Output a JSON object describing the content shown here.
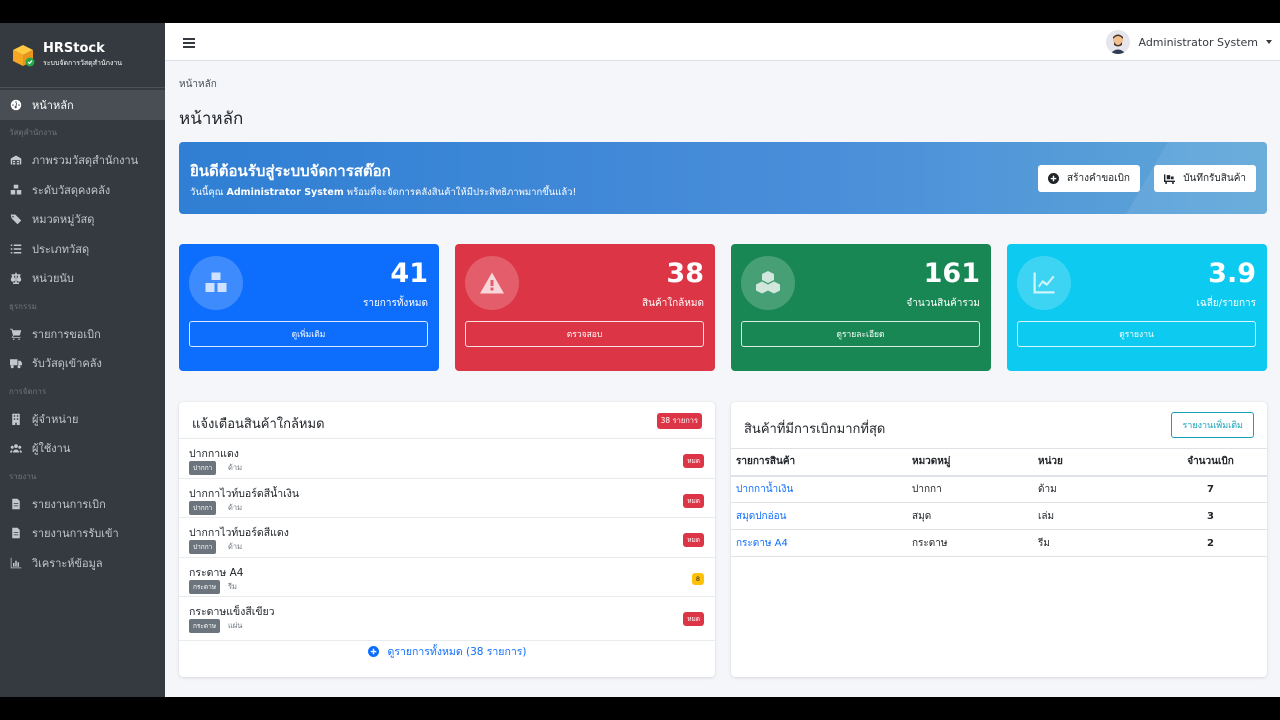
{
  "brand": {
    "title": "HRStock",
    "subtitle": "ระบบจัดการวัสดุสำนักงาน"
  },
  "sidebar": {
    "home": "หน้าหลัก",
    "section_materials": "วัสดุสำนักงาน",
    "materials": [
      "ภาพรวมวัสดุสำนักงาน",
      "ระดับวัสดุคงคลัง",
      "หมวดหมู่วัสดุ",
      "ประเภทวัสดุ",
      "หน่วยนับ"
    ],
    "section_transactions": "ธุรกรรม",
    "transactions": [
      "รายการขอเบิก",
      "รับวัสดุเข้าคลัง"
    ],
    "section_manage": "การจัดการ",
    "manage": [
      "ผู้จำหน่าย",
      "ผู้ใช้งาน"
    ],
    "section_reports": "รายงาน",
    "reports": [
      "รายงานการเบิก",
      "รายงานการรับเข้า",
      "วิเคราะห์ข้อมูล"
    ]
  },
  "topbar": {
    "user_name": "Administrator System"
  },
  "breadcrumb": "หน้าหลัก",
  "page_title": "หน้าหลัก",
  "welcome": {
    "title": "ยินดีต้อนรับสู่ระบบจัดการสต๊อก",
    "prefix": "วันนี้คุณ ",
    "user": "Administrator System",
    "suffix": " พร้อมที่จะจัดการคลังสินค้าให้มีประสิทธิภาพมากขึ้นแล้ว!",
    "btn_request": "สร้างคำขอเบิก",
    "btn_receive": "บันทึกรับสินค้า"
  },
  "stats": [
    {
      "value": "41",
      "label": "รายการทั้งหมด",
      "button": "ดูเพิ่มเติม",
      "color": "#0d6efd"
    },
    {
      "value": "38",
      "label": "สินค้าใกล้หมด",
      "button": "ตรวจสอบ",
      "color": "#dc3545"
    },
    {
      "value": "161",
      "label": "จำนวนสินค้ารวม",
      "button": "ดูรายละเอียด",
      "color": "#198754"
    },
    {
      "value": "3.9",
      "label": "เฉลี่ย/รายการ",
      "button": "ดูรายงาน",
      "color": "#0dcaf0"
    }
  ],
  "low_stock": {
    "title": "แจ้งเตือนสินค้าใกล้หมด",
    "badge": "38 รายการ",
    "items": [
      {
        "name": "ปากกาแดง",
        "category": "ปากกา",
        "unit": "ด้าม",
        "status": "หมด"
      },
      {
        "name": "ปากกาไวท์บอร์ดสีน้ำเงิน",
        "category": "ปากกา",
        "unit": "ด้าม",
        "status": "หมด"
      },
      {
        "name": "ปากกาไวท์บอร์ดสีแดง",
        "category": "ปากกา",
        "unit": "ด้าม",
        "status": "หมด"
      },
      {
        "name": "กระดาษ A4",
        "category": "กระดาษ",
        "unit": "รีม",
        "status": "8"
      },
      {
        "name": "กระดาษแข็งสีเขียว",
        "category": "กระดาษ",
        "unit": "แผ่น",
        "status": "หมด"
      }
    ],
    "view_all": "ดูรายการทั้งหมด (38 รายการ)"
  },
  "top_requested": {
    "title": "สินค้าที่มีการเบิกมากที่สุด",
    "more": "รายงานเพิ่มเติม",
    "headers": [
      "รายการสินค้า",
      "หมวดหมู่",
      "หน่วย",
      "จำนวนเบิก"
    ],
    "rows": [
      [
        "ปากกาน้ำเงิน",
        "ปากกา",
        "ด้าม",
        "7"
      ],
      [
        "สมุดปกอ่อน",
        "สมุด",
        "เล่ม",
        "3"
      ],
      [
        "กระดาษ A4",
        "กระดาษ",
        "รีม",
        "2"
      ]
    ]
  }
}
